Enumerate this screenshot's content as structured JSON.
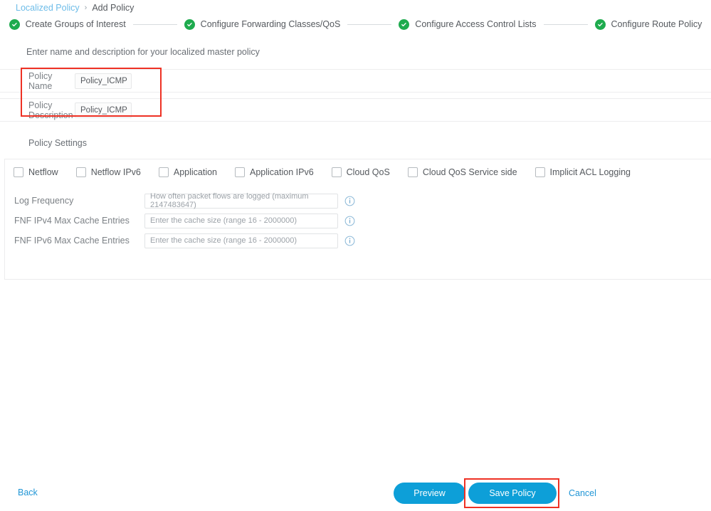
{
  "breadcrumb": {
    "link": "Localized Policy",
    "separator": "›",
    "current": "Add Policy"
  },
  "stepper": {
    "steps": [
      {
        "label": "Create Groups of Interest",
        "state": "complete",
        "icon": "check-circle-icon"
      },
      {
        "label": "Configure Forwarding Classes/QoS",
        "state": "complete",
        "icon": "check-circle-icon"
      },
      {
        "label": "Configure Access Control Lists",
        "state": "complete",
        "icon": "check-circle-icon"
      },
      {
        "label": "Configure Route Policy",
        "state": "complete",
        "icon": "check-circle-icon"
      }
    ],
    "complete_color": "#1eab4e"
  },
  "main": {
    "intro": "Enter name and description for your localized master policy",
    "name_fields": [
      {
        "label": "Policy Name",
        "value": "Policy_ICMP"
      },
      {
        "label": "Policy Description",
        "value": "Policy_ICMP"
      }
    ],
    "settings_title": "Policy Settings",
    "checkboxes": [
      {
        "label": "Netflow",
        "checked": false
      },
      {
        "label": "Netflow IPv6",
        "checked": false
      },
      {
        "label": "Application",
        "checked": false
      },
      {
        "label": "Application IPv6",
        "checked": false
      },
      {
        "label": "Cloud QoS",
        "checked": false
      },
      {
        "label": "Cloud QoS Service side",
        "checked": false
      },
      {
        "label": "Implicit ACL Logging",
        "checked": false
      }
    ],
    "settings_fields": [
      {
        "label": "Log Frequency",
        "value": "",
        "placeholder": "How often packet flows are logged (maximum 2147483647)",
        "info": "info-icon"
      },
      {
        "label": "FNF IPv4 Max Cache Entries",
        "value": "",
        "placeholder": "Enter the cache size (range 16 - 2000000)",
        "info": "info-icon"
      },
      {
        "label": "FNF IPv6 Max Cache Entries",
        "value": "",
        "placeholder": "Enter the cache size (range 16 - 2000000)",
        "info": "info-icon"
      }
    ]
  },
  "footer": {
    "back": "Back",
    "preview": "Preview",
    "save": "Save Policy",
    "cancel": "Cancel",
    "button_color": "#0d9fd8",
    "link_color": "#2196d6"
  },
  "annotations": {
    "highlight_color": "#ee3124",
    "boxes": [
      "policy-name-fields",
      "save-policy-button"
    ]
  }
}
